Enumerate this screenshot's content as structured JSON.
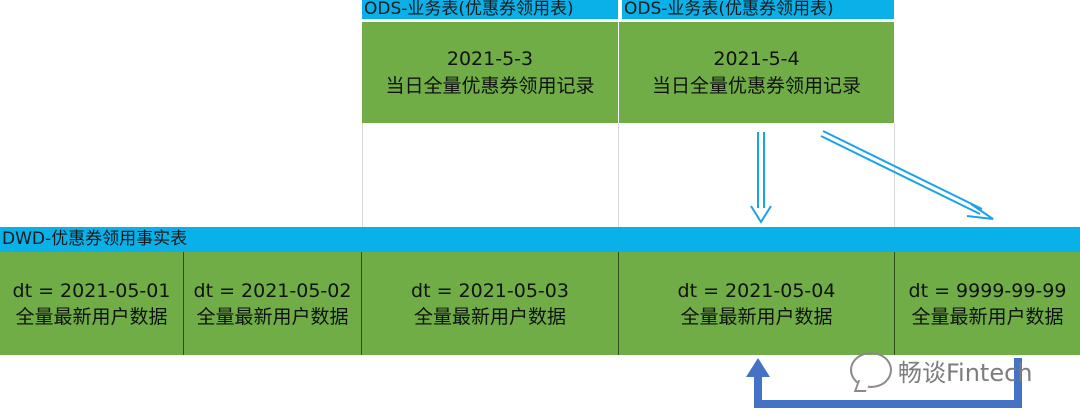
{
  "ods": {
    "tables": [
      {
        "header": "ODS-业务表(优惠券领用表)",
        "date": "2021-5-3",
        "desc": "当日全量优惠券领用记录"
      },
      {
        "header": "ODS-业务表(优惠券领用表)",
        "date": "2021-5-4",
        "desc": "当日全量优惠券领用记录"
      }
    ]
  },
  "dwd": {
    "header": "DWD-优惠券领用事实表",
    "partitions": [
      {
        "dt": "dt = 2021-05-01",
        "desc": "全量最新用户数据"
      },
      {
        "dt": "dt = 2021-05-02",
        "desc": "全量最新用户数据"
      },
      {
        "dt": "dt = 2021-05-03",
        "desc": "全量最新用户数据"
      },
      {
        "dt": "dt = 2021-05-04",
        "desc": "全量最新用户数据"
      },
      {
        "dt": "dt = 9999-99-99",
        "desc": "全量最新用户数据"
      }
    ]
  },
  "watermark": {
    "text": "畅谈Fintech",
    "icon": "wechat-icon"
  },
  "colors": {
    "header_blue": "#0ab0e8",
    "cell_green": "#70ad47",
    "arrow_light_blue": "#1aa3e8",
    "arrow_dark_blue": "#4472c4"
  }
}
